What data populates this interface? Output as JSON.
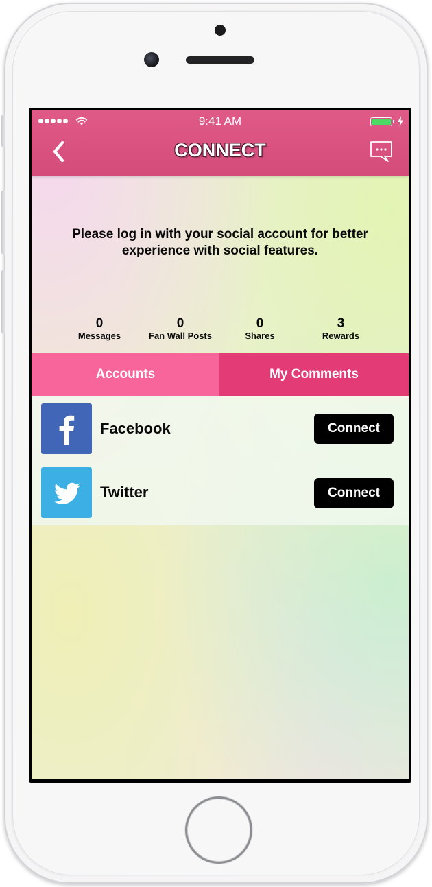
{
  "status_bar": {
    "time": "9:41 AM"
  },
  "navbar": {
    "title": "CONNECT",
    "back_icon": "chevron-left-icon",
    "chat_icon": "chat-bubble-icon"
  },
  "login_message": "Please log in with your social account for better experience with social features.",
  "stats": [
    {
      "value": "0",
      "label": "Messages"
    },
    {
      "value": "0",
      "label": "Fan Wall Posts"
    },
    {
      "value": "0",
      "label": "Shares"
    },
    {
      "value": "3",
      "label": "Rewards"
    }
  ],
  "tabs": [
    {
      "label": "Accounts",
      "selected": true
    },
    {
      "label": "My Comments",
      "selected": false
    }
  ],
  "accounts": [
    {
      "name": "Facebook",
      "icon": "facebook-icon",
      "button": "Connect",
      "color": "#4166b8"
    },
    {
      "name": "Twitter",
      "icon": "twitter-icon",
      "button": "Connect",
      "color": "#3cb0e4"
    }
  ],
  "colors": {
    "navbar": "#d94f7e",
    "tab_selected": "#f7659a",
    "tab_unselected": "#e23b75",
    "button": "#000000"
  }
}
